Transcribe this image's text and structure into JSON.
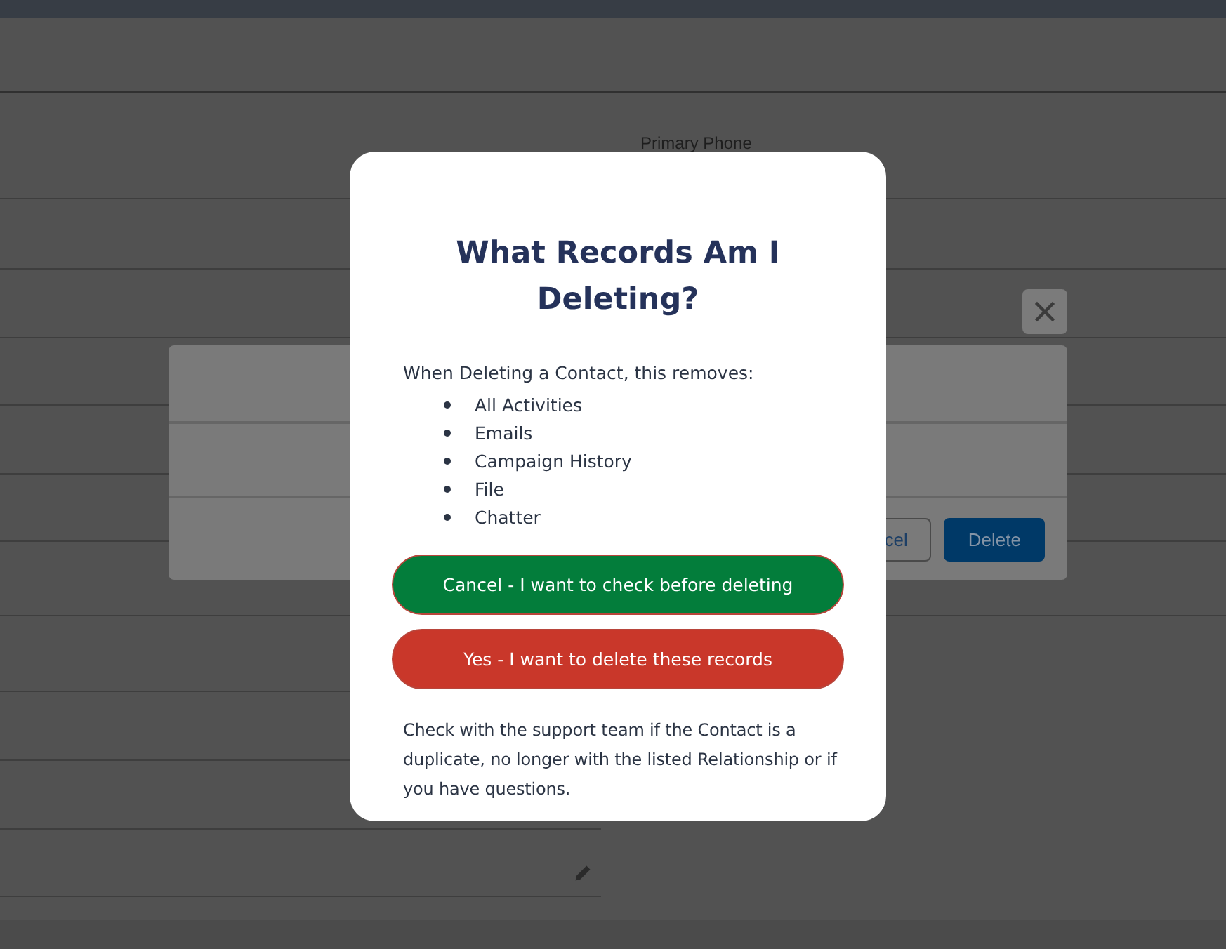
{
  "background_page": {
    "field_label": "Primary Phone"
  },
  "background_dialog": {
    "buttons": [
      {
        "label": "cel",
        "kind": "outline"
      },
      {
        "label": "Delete",
        "kind": "brand"
      }
    ]
  },
  "modal": {
    "title": "What Records Am I Deleting?",
    "intro": "When Deleting a Contact, this removes:",
    "items": [
      "All Activities",
      "Emails",
      "Campaign History",
      "File",
      "Chatter"
    ],
    "buttons": [
      {
        "label": "Cancel - I want to check before deleting",
        "kind": "cancel"
      },
      {
        "label": "Yes - I want to delete these records",
        "kind": "delete"
      }
    ],
    "note": "Check with the support team if the Contact is a duplicate, no longer with the listed Relationship or if you have questions."
  }
}
